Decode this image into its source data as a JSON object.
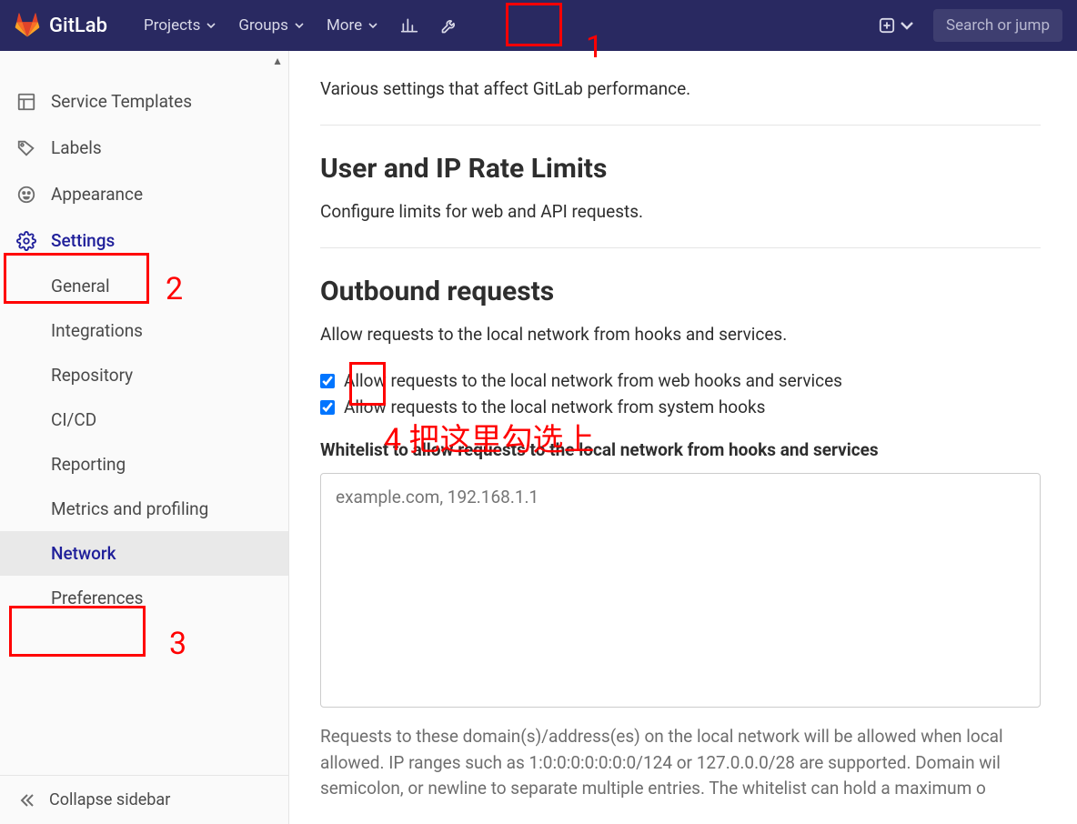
{
  "brand": "GitLab",
  "nav": {
    "projects": "Projects",
    "groups": "Groups",
    "more": "More",
    "search_placeholder": "Search or jump"
  },
  "sidebar": {
    "items": [
      {
        "label": "Service Templates"
      },
      {
        "label": "Labels"
      },
      {
        "label": "Appearance"
      },
      {
        "label": "Settings"
      }
    ],
    "settings_children": [
      {
        "label": "General"
      },
      {
        "label": "Integrations"
      },
      {
        "label": "Repository"
      },
      {
        "label": "CI/CD"
      },
      {
        "label": "Reporting"
      },
      {
        "label": "Metrics and profiling"
      },
      {
        "label": "Network"
      },
      {
        "label": "Preferences"
      }
    ],
    "collapse": "Collapse sidebar"
  },
  "main": {
    "perf_desc": "Various settings that affect GitLab performance.",
    "rate_title": "User and IP Rate Limits",
    "rate_desc": "Configure limits for web and API requests.",
    "outbound_title": "Outbound requests",
    "outbound_desc": "Allow requests to the local network from hooks and services.",
    "cb1": "Allow requests to the local network from web hooks and services",
    "cb2": "Allow requests to the local network from system hooks",
    "whitelist_label": "Whitelist to allow requests to the local network from hooks and services",
    "whitelist_placeholder": "example.com, 192.168.1.1",
    "help": "Requests to these domain(s)/address(es) on the local network will be allowed when local allowed. IP ranges such as 1:0:0:0:0:0:0:0/124 or 127.0.0.0/28 are supported. Domain wil semicolon, or newline to separate multiple entries. The whitelist can hold a maximum o"
  },
  "annotations": {
    "a1": "1",
    "a2": "2",
    "a3": "3",
    "a4": "4 把这里勾选上"
  }
}
